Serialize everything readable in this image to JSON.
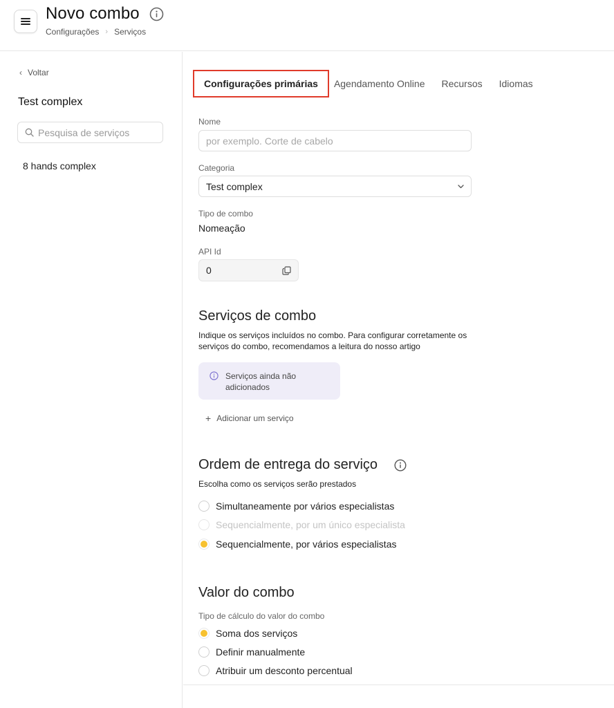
{
  "header": {
    "title": "Novo combo",
    "breadcrumb": [
      "Configurações",
      "Serviços"
    ],
    "menu_icon": "hamburger-menu-icon",
    "info_icon": "info-icon"
  },
  "sidebar": {
    "back_label": "Voltar",
    "title": "Test complex",
    "search_placeholder": "Pesquisa de serviços",
    "items": [
      "8 hands complex"
    ]
  },
  "tabs": [
    {
      "label": "Configurações primárias",
      "active": true
    },
    {
      "label": "Agendamento Online",
      "active": false
    },
    {
      "label": "Recursos",
      "active": false
    },
    {
      "label": "Idiomas",
      "active": false
    }
  ],
  "form": {
    "name_label": "Nome",
    "name_placeholder": "por exemplo. Corte de cabelo",
    "name_value": "",
    "category_label": "Categoria",
    "category_value": "Test complex",
    "combo_type_label": "Tipo de combo",
    "combo_type_value": "Nomeação",
    "api_label": "API Id",
    "api_value": "0"
  },
  "services_section": {
    "title": "Serviços de combo",
    "description": "Indique os serviços incluídos no combo. Para configurar corretamente os serviços do combo, recomendamos a leitura do nosso artigo",
    "empty_message": "Serviços ainda não adicionados",
    "add_label": "Adicionar um serviço"
  },
  "delivery_section": {
    "title": "Ordem de entrega do serviço",
    "subtitle": "Escolha como os serviços serão prestados",
    "options": [
      {
        "label": "Simultaneamente por vários especialistas",
        "selected": false,
        "disabled": false
      },
      {
        "label": "Sequencialmente, por um único especialista",
        "selected": false,
        "disabled": true
      },
      {
        "label": "Sequencialmente, por vários especialistas",
        "selected": true,
        "disabled": false
      }
    ]
  },
  "value_section": {
    "title": "Valor do combo",
    "subtitle": "Tipo de cálculo do valor do combo",
    "options": [
      {
        "label": "Soma dos serviços",
        "selected": true
      },
      {
        "label": "Definir manualmente",
        "selected": false
      },
      {
        "label": "Atribuir um desconto percentual",
        "selected": false
      }
    ]
  },
  "colors": {
    "accent": "#f7c12f",
    "highlight_border": "#e03a2a",
    "info_bg": "#efedf8",
    "info_icon": "#7a6fd0"
  }
}
